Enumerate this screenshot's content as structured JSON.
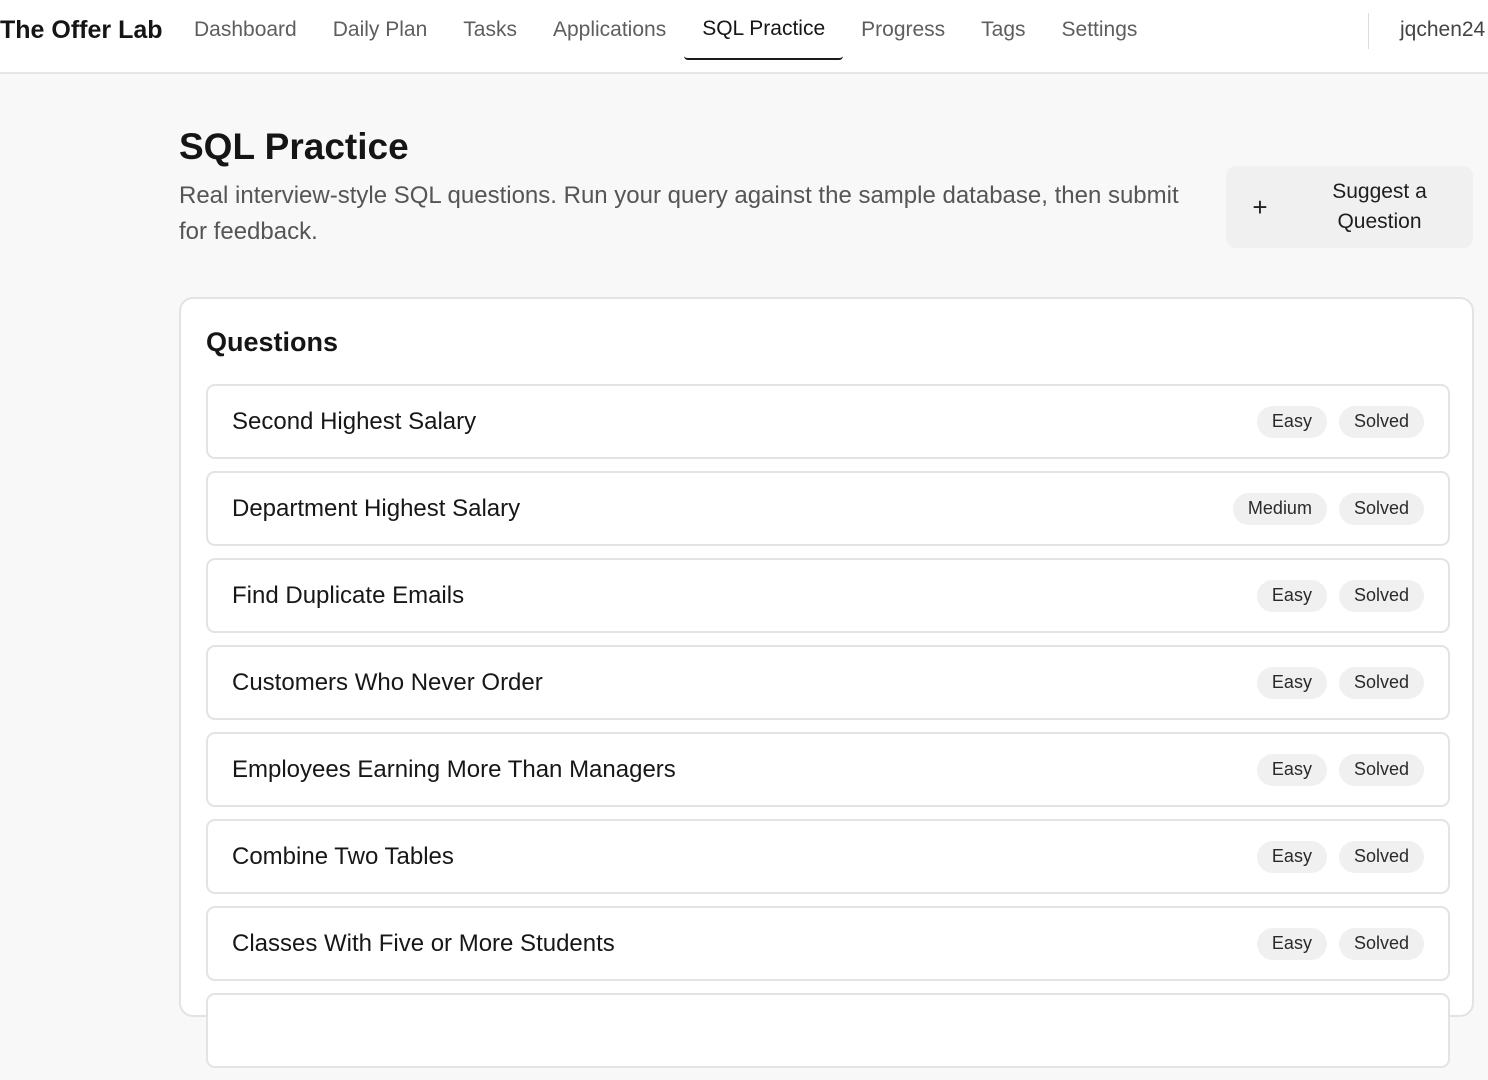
{
  "app": {
    "brand": "The Offer Lab",
    "user": "jqchen24"
  },
  "nav": {
    "tabs": [
      {
        "label": "Dashboard"
      },
      {
        "label": "Daily Plan"
      },
      {
        "label": "Tasks"
      },
      {
        "label": "Applications"
      },
      {
        "label": "SQL Practice",
        "active": true
      },
      {
        "label": "Progress"
      },
      {
        "label": "Tags"
      },
      {
        "label": "Settings"
      }
    ]
  },
  "page": {
    "title": "SQL Practice",
    "description": "Real interview-style SQL questions. Run your query against the sample database, then submit for feedback.",
    "suggest_button": {
      "icon": "plus-icon",
      "label": "Suggest a Question"
    }
  },
  "questions": {
    "heading": "Questions",
    "items": [
      {
        "title": "Second Highest Salary",
        "difficulty": "Easy",
        "status": "Solved"
      },
      {
        "title": "Department Highest Salary",
        "difficulty": "Medium",
        "status": "Solved"
      },
      {
        "title": "Find Duplicate Emails",
        "difficulty": "Easy",
        "status": "Solved"
      },
      {
        "title": "Customers Who Never Order",
        "difficulty": "Easy",
        "status": "Solved"
      },
      {
        "title": "Employees Earning More Than Managers",
        "difficulty": "Easy",
        "status": "Solved"
      },
      {
        "title": "Combine Two Tables",
        "difficulty": "Easy",
        "status": "Solved"
      },
      {
        "title": "Classes With Five or More Students",
        "difficulty": "Easy",
        "status": "Solved"
      },
      {
        "title": "",
        "difficulty": "",
        "status": ""
      }
    ]
  }
}
